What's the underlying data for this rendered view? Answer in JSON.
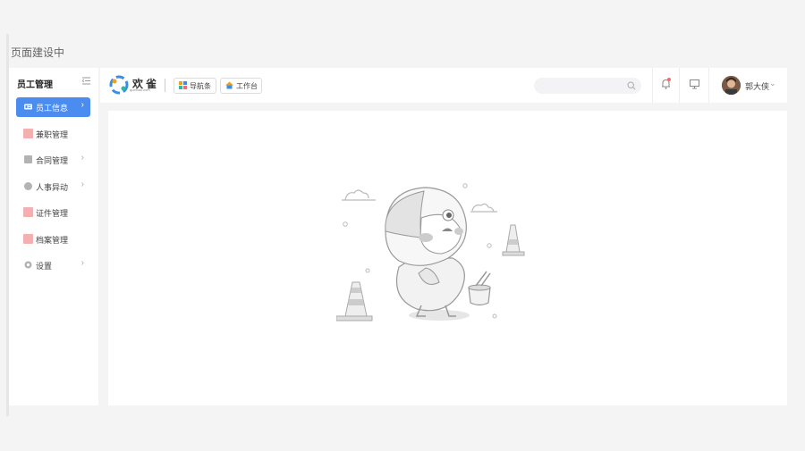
{
  "page": {
    "caption": "页面建设中"
  },
  "sidebar": {
    "title": "员工管理",
    "items": [
      {
        "label": "员工信息",
        "icon": "id-card-icon",
        "chevron": "›",
        "active": true
      },
      {
        "label": "兼职管理",
        "icon": "part-time-icon",
        "chevron": ""
      },
      {
        "label": "合同管理",
        "icon": "contract-icon",
        "chevron": "›"
      },
      {
        "label": "人事异动",
        "icon": "transfer-icon",
        "chevron": "›"
      },
      {
        "label": "证件管理",
        "icon": "certificate-icon",
        "chevron": ""
      },
      {
        "label": "档案管理",
        "icon": "archive-icon",
        "chevron": ""
      },
      {
        "label": "设置",
        "icon": "settings-icon",
        "chevron": "›"
      }
    ]
  },
  "header": {
    "logo_text": "欢雀",
    "logo_sub": "quexiao.com",
    "nav_button": "导航条",
    "workbench_button": "工作台",
    "search_placeholder": "",
    "user_name": "郭大侠",
    "user_chevron": "⌄"
  },
  "colors": {
    "accent": "#4b8cf0",
    "badge": "#f56c6c",
    "pink": "#f4b0b0"
  }
}
